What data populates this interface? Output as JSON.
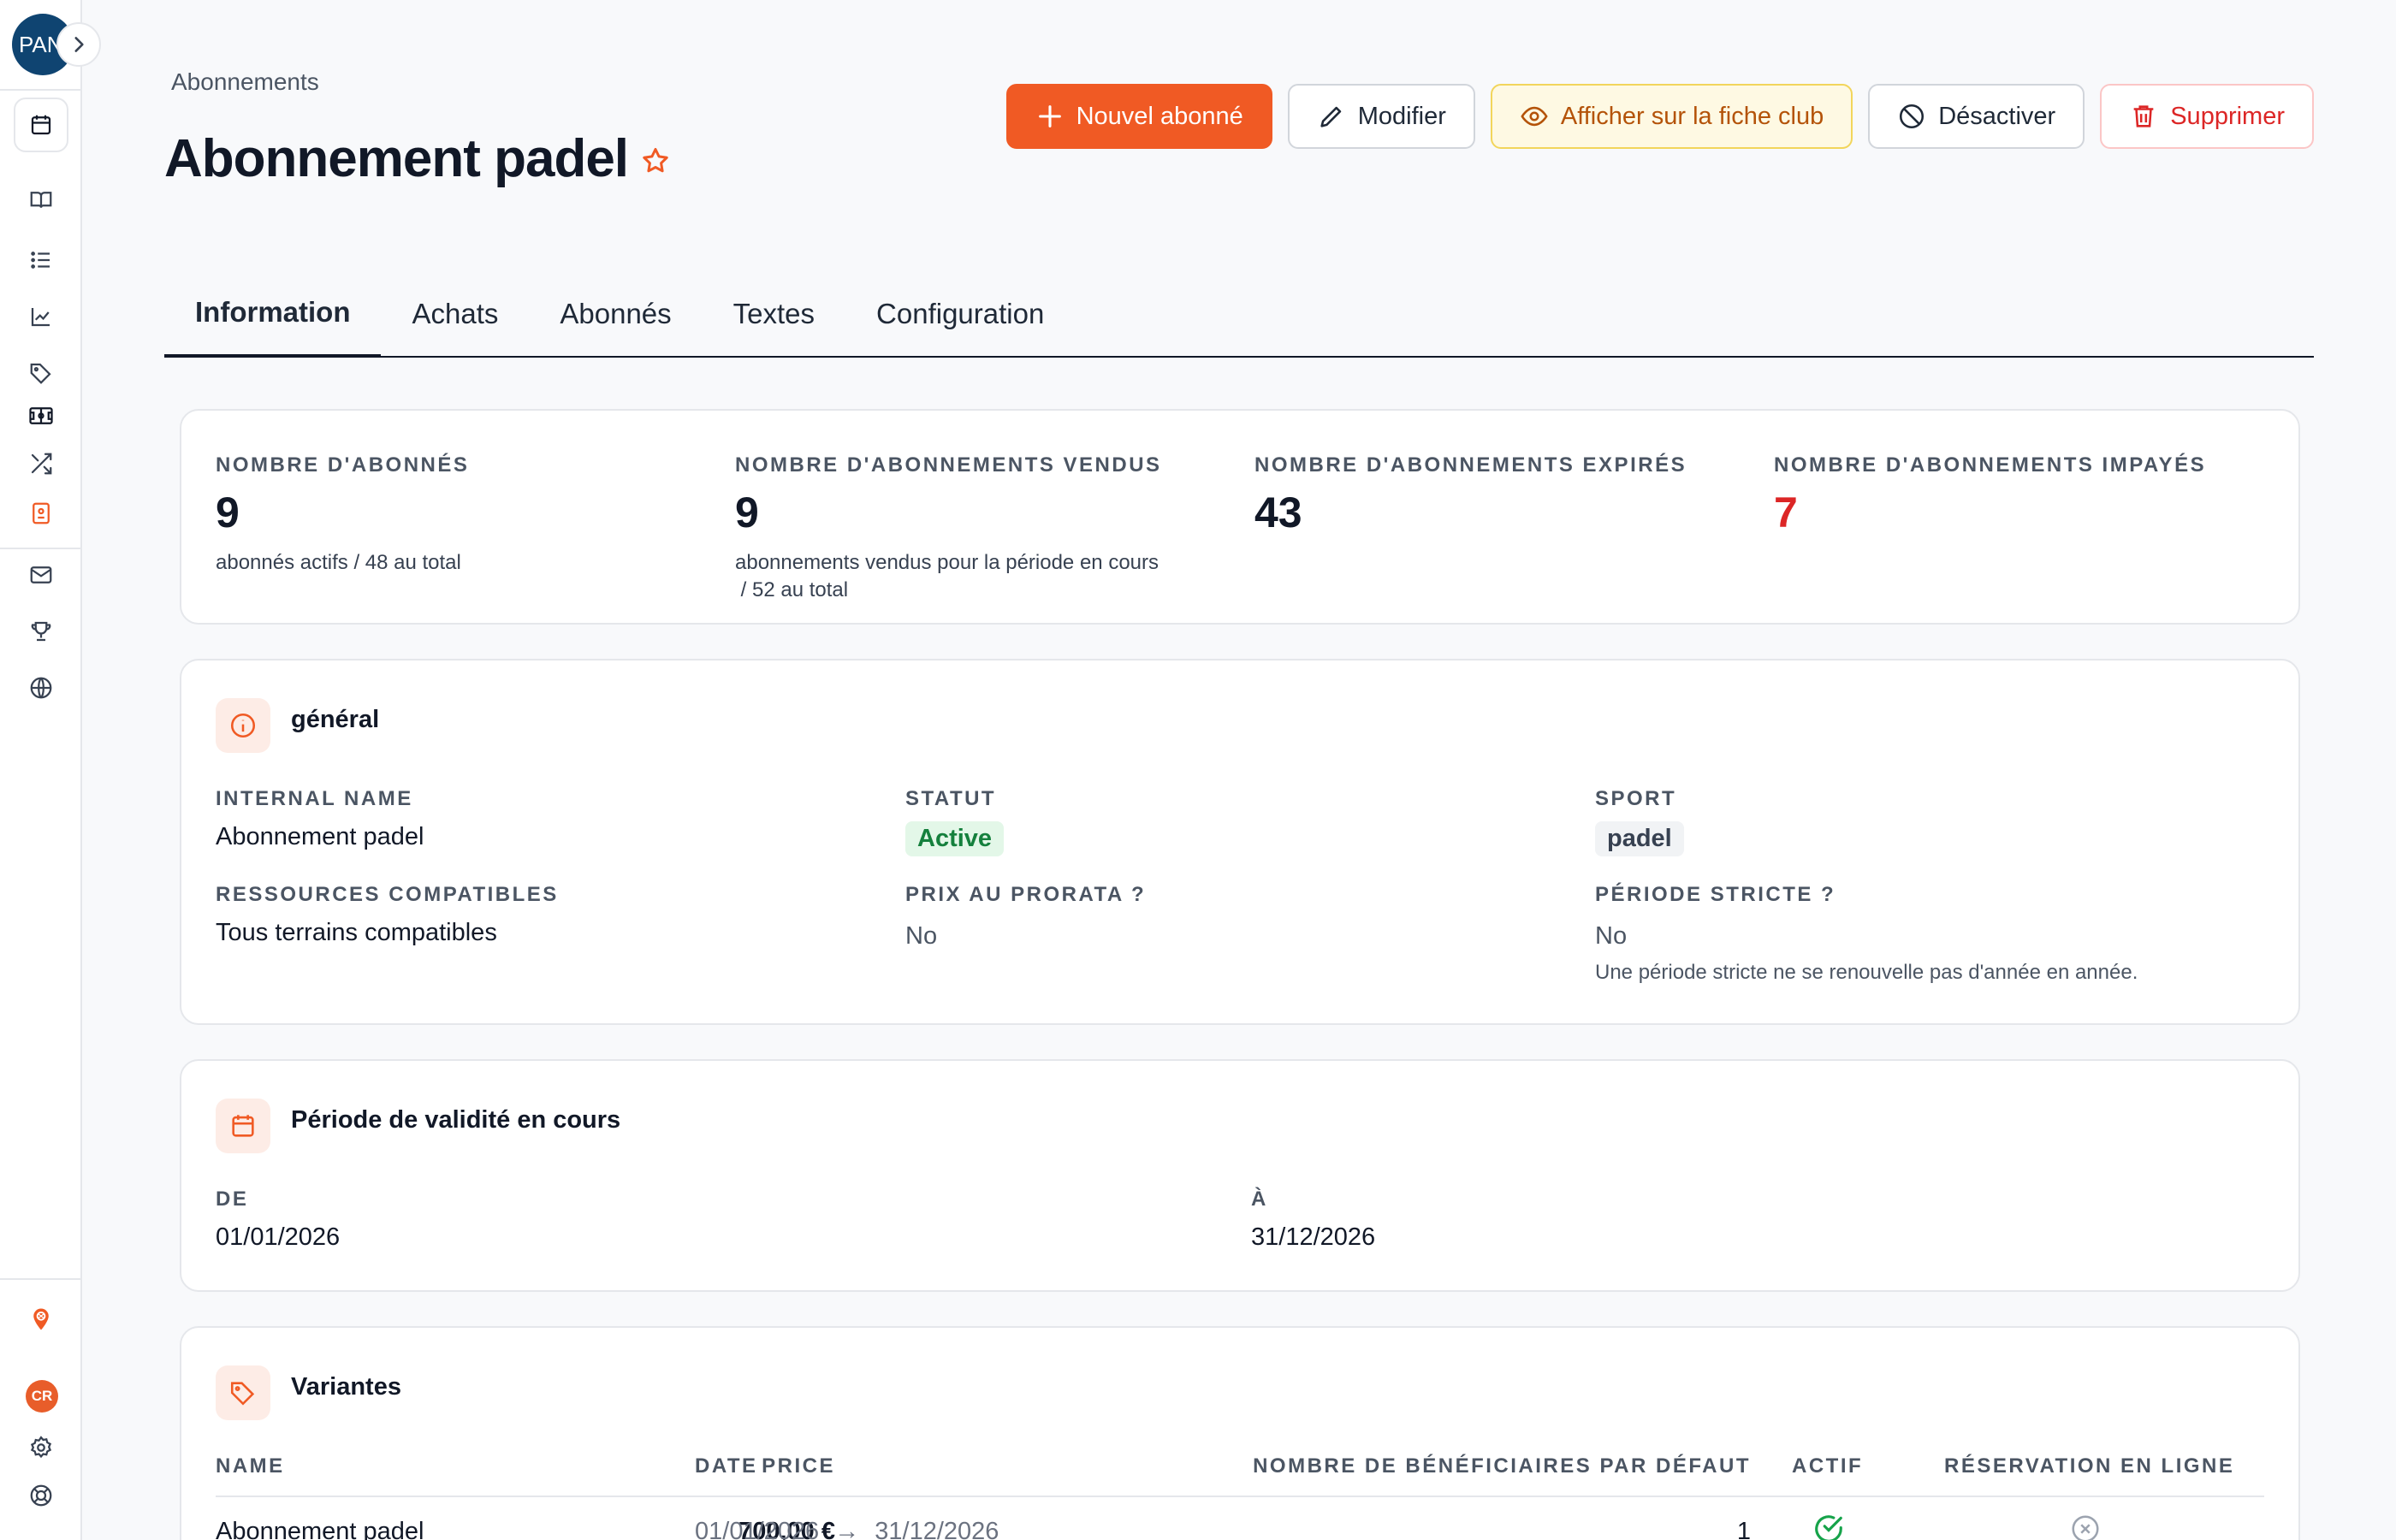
{
  "sidebar": {
    "avatar_text": "PAN",
    "cr_badge": "CR"
  },
  "header": {
    "breadcrumb": "Abonnements",
    "title": "Abonnement padel",
    "actions": {
      "new": "Nouvel abonné",
      "edit": "Modifier",
      "show": "Afficher sur la fiche club",
      "deactivate": "Désactiver",
      "delete": "Supprimer"
    }
  },
  "tabs": [
    "Information",
    "Achats",
    "Abonnés",
    "Textes",
    "Configuration"
  ],
  "stats": [
    {
      "label": "NOMBRE D'ABONNÉS",
      "value": "9",
      "sub1": "abonnés actifs  / 48 au total",
      "sub2": ""
    },
    {
      "label": "NOMBRE D'ABONNEMENTS VENDUS",
      "value": "9",
      "sub1": "abonnements vendus pour la période en cours",
      "sub2": " / 52 au total"
    },
    {
      "label": "NOMBRE D'ABONNEMENTS EXPIRÉS",
      "value": "43",
      "sub1": "",
      "sub2": ""
    },
    {
      "label": "NOMBRE D'ABONNEMENTS IMPAYÉS",
      "value": "7",
      "sub1": "",
      "sub2": ""
    }
  ],
  "general": {
    "title": "général",
    "internal_name_label": "INTERNAL NAME",
    "internal_name": "Abonnement padel",
    "statut_label": "STATUT",
    "statut": "Active",
    "sport_label": "SPORT",
    "sport": "padel",
    "ressources_label": "RESSOURCES COMPATIBLES",
    "ressources": "Tous terrains compatibles",
    "prorata_label": "PRIX AU PRORATA ?",
    "prorata": "No",
    "stricte_label": "PÉRIODE STRICTE ?",
    "stricte": "No",
    "stricte_note": "Une période stricte ne se renouvelle pas d'année en année."
  },
  "validity": {
    "title": "Période de validité en cours",
    "from_label": "DE",
    "from": "01/01/2026",
    "to_label": "À",
    "to": "31/12/2026"
  },
  "variants": {
    "title": "Variantes",
    "columns": {
      "name": "NAME",
      "price": "PRICE",
      "date": "DATE",
      "beneficiaires": "NOMBRE DE BÉNÉFICIAIRES PAR DÉFAUT",
      "actif": "ACTIF",
      "reservation": "RÉSERVATION EN LIGNE"
    },
    "rows": [
      {
        "name": "Abonnement padel",
        "price": "700,00 €",
        "date_from": "01/01/2026",
        "arrow": "→",
        "date_to": "31/12/2026",
        "beneficiaires": "1",
        "actif": true,
        "reservation": false
      }
    ]
  },
  "colors": {
    "accent": "#f05a24",
    "danger": "#dc2626",
    "success": "#16a34a",
    "warning": "#b45309"
  }
}
